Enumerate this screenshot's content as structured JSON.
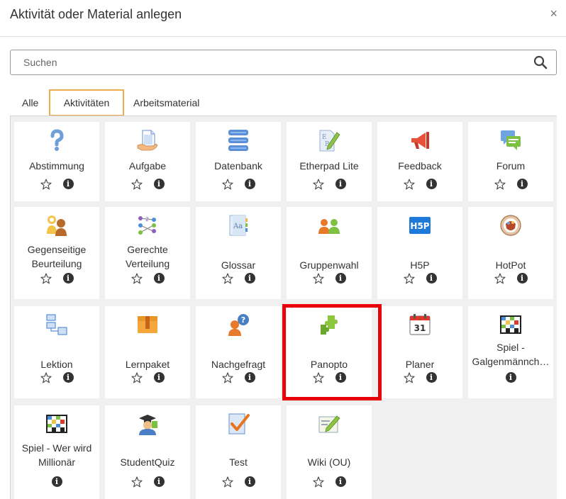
{
  "modal": {
    "title": "Aktivität oder Material anlegen",
    "close": "×"
  },
  "search": {
    "placeholder": "Suchen"
  },
  "tabs": [
    {
      "label": "Alle"
    },
    {
      "label": "Aktivitäten",
      "active": true
    },
    {
      "label": "Arbeitsmaterial"
    }
  ],
  "accent_color": "#f0ad4e",
  "highlight_color": "#e8000a",
  "modules": [
    {
      "name": "Abstimmung",
      "icon": "question-icon",
      "star": true
    },
    {
      "name": "Aufgabe",
      "icon": "assignment-icon",
      "star": true
    },
    {
      "name": "Datenbank",
      "icon": "database-icon",
      "star": true
    },
    {
      "name": "Etherpad Lite",
      "icon": "etherpad-icon",
      "star": true
    },
    {
      "name": "Feedback",
      "icon": "megaphone-icon",
      "star": true
    },
    {
      "name": "Forum",
      "icon": "forum-icon",
      "star": true
    },
    {
      "line1": "Gegenseitige",
      "line2": "Beurteilung",
      "icon": "workshop-icon",
      "star": true
    },
    {
      "line1": "Gerechte",
      "line2": "Verteilung",
      "icon": "ratingallocate-icon",
      "star": true
    },
    {
      "name": "Glossar",
      "icon": "glossary-icon",
      "star": true
    },
    {
      "name": "Gruppenwahl",
      "icon": "groupchoice-icon",
      "star": true
    },
    {
      "name": "H5P",
      "icon": "h5p-icon",
      "star": true
    },
    {
      "name": "HotPot",
      "icon": "hotpot-icon",
      "star": true
    },
    {
      "name": "Lektion",
      "icon": "lesson-icon",
      "star": true
    },
    {
      "name": "Lernpaket",
      "icon": "scorm-package-icon",
      "star": true
    },
    {
      "name": "Nachgefragt",
      "icon": "questionnaire-icon",
      "star": true
    },
    {
      "name": "Panopto",
      "icon": "puzzle-icon",
      "star": true
    },
    {
      "name": "Planer",
      "icon": "calendar-icon",
      "star": true,
      "calendar_day": "31"
    },
    {
      "line1": "Spiel -",
      "line2": "Galgenmännch…",
      "icon": "game-icon",
      "star": false
    },
    {
      "line1": "Spiel - Wer wird",
      "line2": "Millionär",
      "icon": "game-icon",
      "star": false
    },
    {
      "name": "StudentQuiz",
      "icon": "studentquiz-icon",
      "star": true
    },
    {
      "name": "Test",
      "icon": "quiz-icon",
      "star": true
    },
    {
      "name": "Wiki (OU)",
      "icon": "wiki-icon",
      "star": true
    }
  ]
}
